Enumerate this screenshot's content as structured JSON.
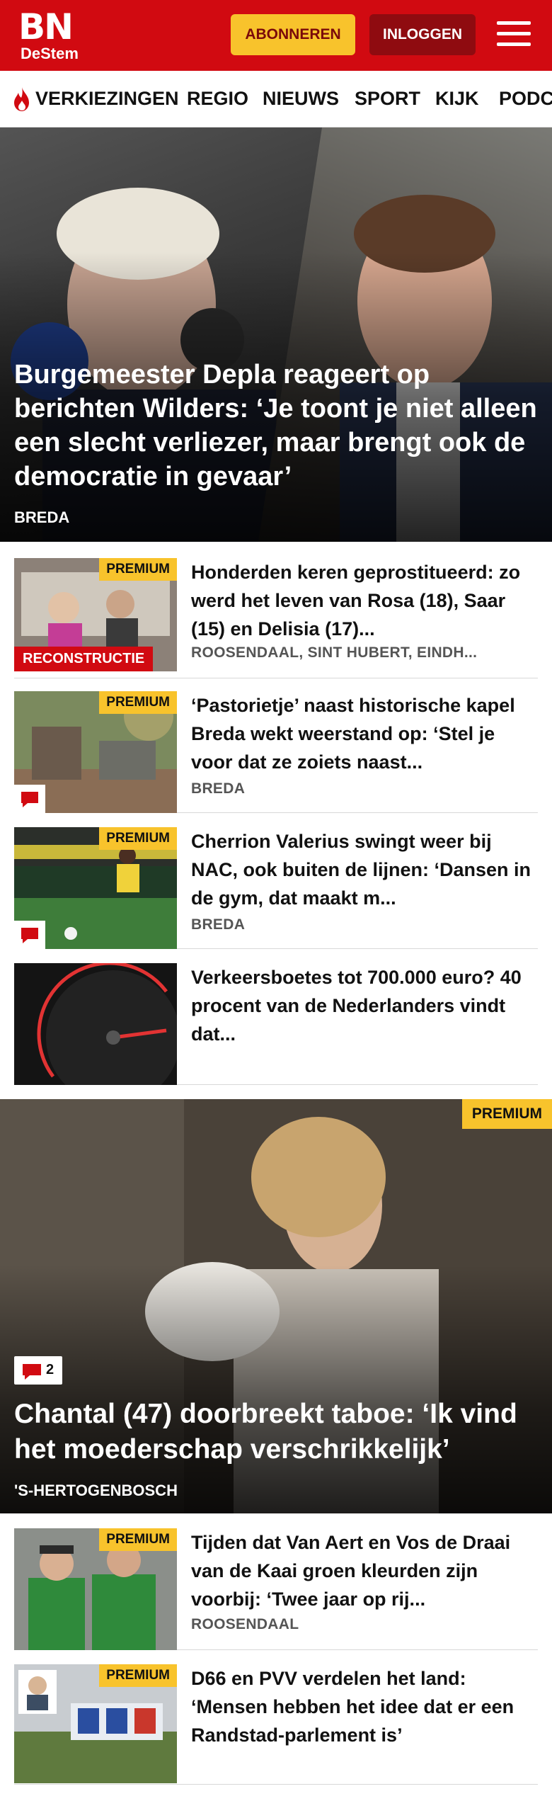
{
  "header": {
    "logo_main": "BN",
    "logo_sub": "DeStem",
    "subscribe_label": "ABONNEREN",
    "login_label": "INLOGGEN",
    "menu_icon": "hamburger-icon",
    "brand_color": "#d10a11",
    "accent_color": "#f8c32c"
  },
  "nav": {
    "items": [
      "VERKIEZINGEN",
      "REGIO",
      "NIEUWS",
      "SPORT",
      "KIJK",
      "PODC"
    ],
    "first_item_icon": "flame-icon"
  },
  "hero": {
    "title": "Burgemeester Depla reageert op berichten Wilders: ‘Je toont je niet alleen een slecht verliezer, maar brengt ook de democratie in gevaar’",
    "place": "BREDA"
  },
  "articles": [
    {
      "premium_label": "PREMIUM",
      "badge": "RECONSTRUCTIE",
      "title": "Honderden keren geprostitueerd: zo werd het leven van Rosa (18), Saar (15) en Delisia (17)...",
      "place": "ROOSENDAAL, SINT HUBERT, EINDH..."
    },
    {
      "premium_label": "PREMIUM",
      "comment_icon": "comment-icon",
      "title": "‘Pastorietje’ naast historische kapel Breda wekt weerstand op: ‘Stel je voor dat ze zoiets naast...",
      "place": "BREDA"
    },
    {
      "premium_label": "PREMIUM",
      "comment_icon": "comment-icon",
      "title": "Cherrion Valerius swingt weer bij NAC, ook buiten de lijnen: ‘Dansen in de gym, dat maakt m...",
      "place": "BREDA"
    },
    {
      "title": "Verkeersboetes tot 700.000 euro? 40 procent van de Nederlanders vindt dat..."
    }
  ],
  "feature": {
    "premium_label": "PREMIUM",
    "comment_count": "2",
    "title": "Chantal (47) doorbreekt taboe: ‘Ik vind het moederschap verschrikkelijk’",
    "place": "'S-HERTOGENBOSCH"
  },
  "articles2": [
    {
      "premium_label": "PREMIUM",
      "title": "Tijden dat Van Aert en Vos de Draai van de Kaai groen kleurden zijn voorbij: ‘Twee jaar op rij...",
      "place": "ROOSENDAAL"
    },
    {
      "premium_label": "PREMIUM",
      "title": "D66 en PVV verdelen het land: ‘Mensen hebben het idee dat er een Randstad-parlement is’"
    }
  ]
}
